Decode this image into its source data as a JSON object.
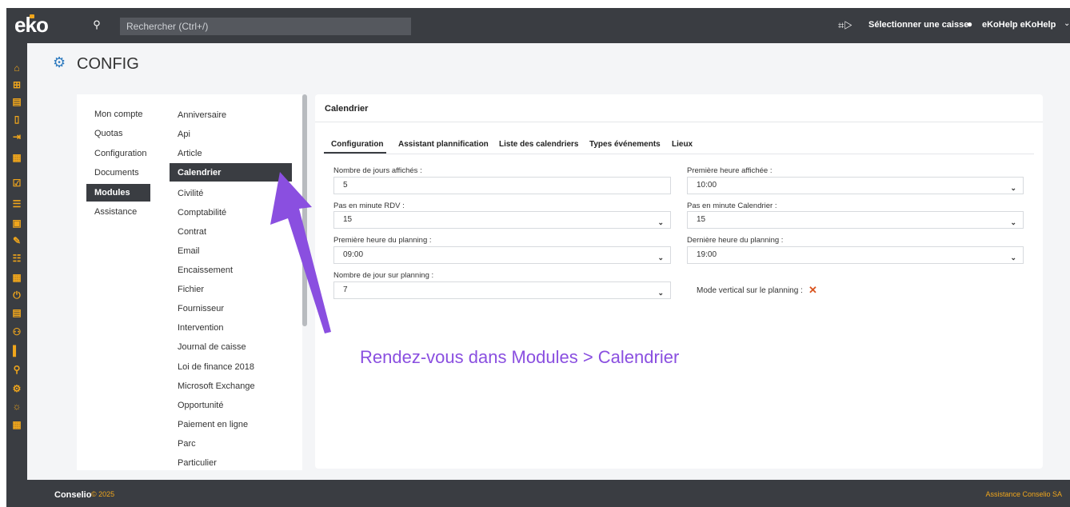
{
  "topbar": {
    "logo": "eko",
    "search_placeholder": "Rechercher (Ctrl+/)",
    "cash_label": "Sélectionner une caisse",
    "user_label": "eKoHelp eKoHelp"
  },
  "header": {
    "title": "CONFIG"
  },
  "nav1": {
    "items": [
      "Mon compte",
      "Quotas",
      "Configuration",
      "Documents",
      "Modules",
      "Assistance"
    ],
    "active": "Modules"
  },
  "nav2": {
    "items": [
      "Anniversaire",
      "Api",
      "Article",
      "Calendrier",
      "Civilité",
      "Comptabilité",
      "Contrat",
      "Email",
      "Encaissement",
      "Fichier",
      "Fournisseur",
      "Intervention",
      "Journal de caisse",
      "Loi de finance 2018",
      "Microsoft Exchange",
      "Opportunité",
      "Paiement en ligne",
      "Parc",
      "Particulier"
    ],
    "active": "Calendrier"
  },
  "card": {
    "title": "Calendrier",
    "tabs": [
      "Configuration",
      "Assistant plannification",
      "Liste des calendriers",
      "Types événements",
      "Lieux"
    ],
    "active_tab": "Configuration",
    "fields": {
      "nb_jours_label": "Nombre de jours affichés :",
      "nb_jours_value": "5",
      "premiere_heure_label": "Première heure affichée :",
      "premiere_heure_value": "10:00",
      "pas_rdv_label": "Pas en minute RDV :",
      "pas_rdv_value": "15",
      "pas_cal_label": "Pas en minute Calendrier :",
      "pas_cal_value": "15",
      "premiere_planning_label": "Première heure du planning :",
      "premiere_planning_value": "09:00",
      "derniere_planning_label": "Dernière heure du planning :",
      "derniere_planning_value": "19:00",
      "nb_jour_planning_label": "Nombre de jour sur planning :",
      "nb_jour_planning_value": "7",
      "mode_vertical_label": "Mode vertical sur le planning :",
      "mode_vertical_value": "✕"
    }
  },
  "annotation": "Rendez-vous dans Modules > Calendrier",
  "footer": {
    "brand": "Conselio",
    "year": "© 2025",
    "support": "Assistance Conselio SA"
  },
  "colors": {
    "dark": "#3a3d42",
    "accent": "#f0a61c",
    "annotation": "#8a4fe0",
    "icon_blue": "#2f7bbf"
  }
}
